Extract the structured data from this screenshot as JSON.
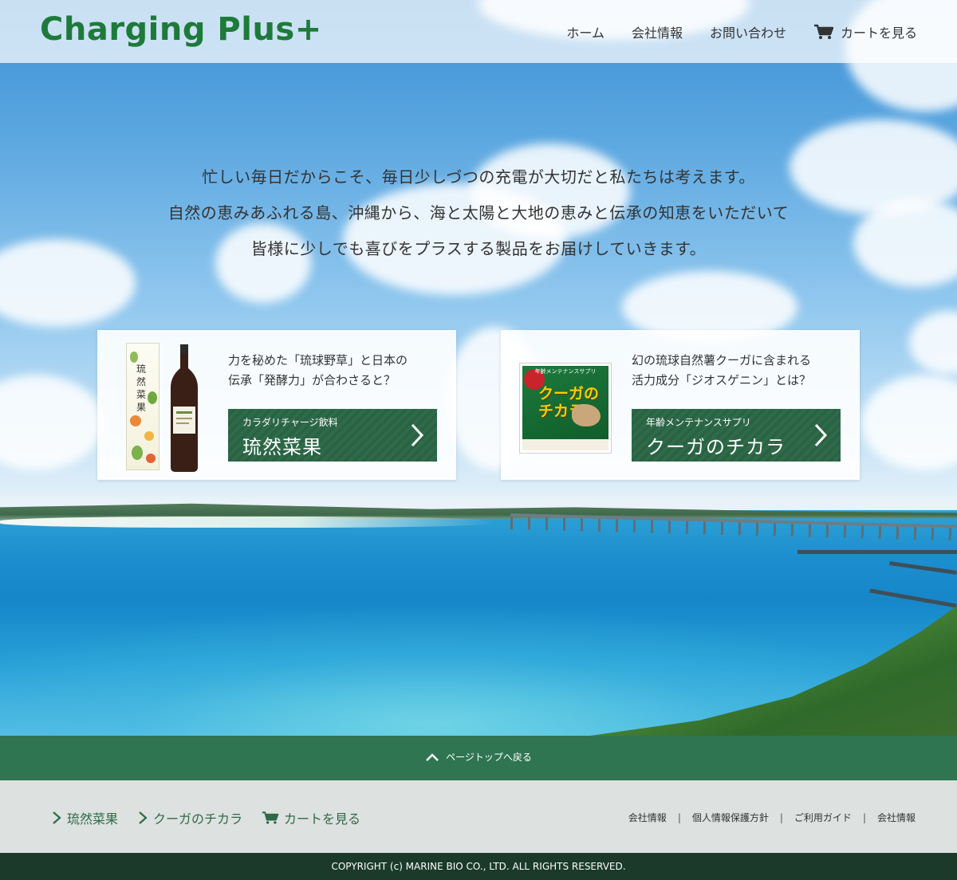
{
  "header": {
    "logo": "Charging Plus+",
    "nav": {
      "home": "ホーム",
      "company": "会社情報",
      "contact": "お問い合わせ",
      "cart": "カートを見る"
    }
  },
  "intro": {
    "line1": "忙しい毎日だからこそ、毎日少しづつの充電が大切だと私たちは考えます。",
    "line2": "自然の恵みあふれる島、沖縄から、海と太陽と大地の恵みと伝承の知恵をいただいて",
    "line3": "皆様に少しでも喜びをプラスする製品をお届けしていきます。"
  },
  "products": [
    {
      "desc_line1": "力を秘めた「琉球野草」と日本の",
      "desc_line2": "伝承「発酵力」が合わさると？",
      "button_sub": "カラダリチャージ飲料",
      "button_main": "琉然菜果",
      "package_text": "琉然菜果"
    },
    {
      "desc_line1": "幻の琉球自然薯クーガに含まれる",
      "desc_line2": "活力成分「ジオスゲニン」とは？",
      "button_sub": "年齢メンテナンスサプリ",
      "button_main": "クーガのチカラ",
      "package_top": "年齢メンテナンスサプリ",
      "package_title_1": "クーガの",
      "package_title_2": "チカラ"
    }
  ],
  "pagetop": {
    "label": "ページトップへ戻る"
  },
  "subfooter": {
    "links": {
      "product1": "琉然菜果",
      "product2": "クーガのチカラ",
      "cart": "カートを見る"
    },
    "legal": {
      "company": "会社情報",
      "privacy": "個人情報保護方針",
      "guide": "ご利用ガイド",
      "company2": "会社情報",
      "separator": "|"
    }
  },
  "footer": {
    "copyright": "COPYRIGHT (c) MARINE BIO CO., LTD. ALL RIGHTS RESERVED."
  },
  "colors": {
    "brand_green": "#1e7a3a",
    "button_green": "#2f6b4a",
    "pagetop_green": "#2f7551",
    "subfooter_bg": "#dde1e0",
    "copyright_bg": "#1b3a2a"
  },
  "icons": {
    "cart": "cart-icon",
    "chevron_right": "chevron-right-icon",
    "chevron_up": "chevron-up-icon"
  }
}
